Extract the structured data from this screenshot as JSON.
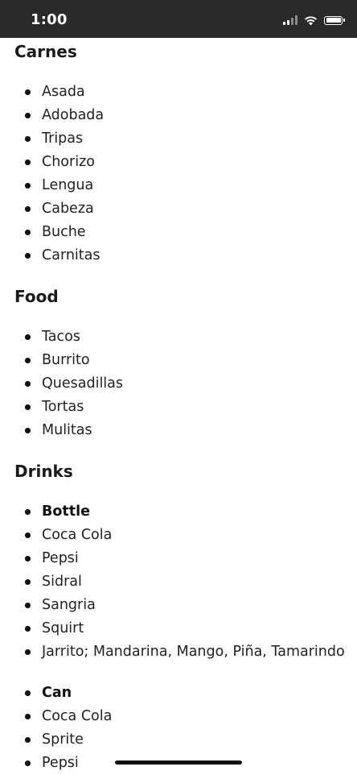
{
  "status_bar": {
    "time": "1:00",
    "icons": [
      "signal-icon",
      "wifi-icon",
      "battery-icon"
    ],
    "background": "#2a2a2a"
  },
  "sections": {
    "carnes": {
      "title": "Carnes",
      "items": [
        "Asada",
        "Adobada",
        "Tripas",
        "Chorizo",
        "Lengua",
        "Cabeza",
        "Buche",
        "Carnitas"
      ]
    },
    "food": {
      "title": "Food",
      "items": [
        "Tacos",
        "Burrito",
        "Quesadillas",
        "Tortas",
        "Mulitas"
      ]
    },
    "drinks": {
      "title": "Drinks",
      "bottle": {
        "label": "Bottle",
        "items": [
          "Coca Cola",
          "Pepsi",
          "Sidral",
          "Sangria",
          "Squirt",
          "Jarrito; Mandarina, Mango, Piña, Tamarindo"
        ]
      },
      "can": {
        "label": "Can",
        "items": [
          "Coca Cola",
          "Sprite",
          "Pepsi"
        ]
      }
    }
  }
}
